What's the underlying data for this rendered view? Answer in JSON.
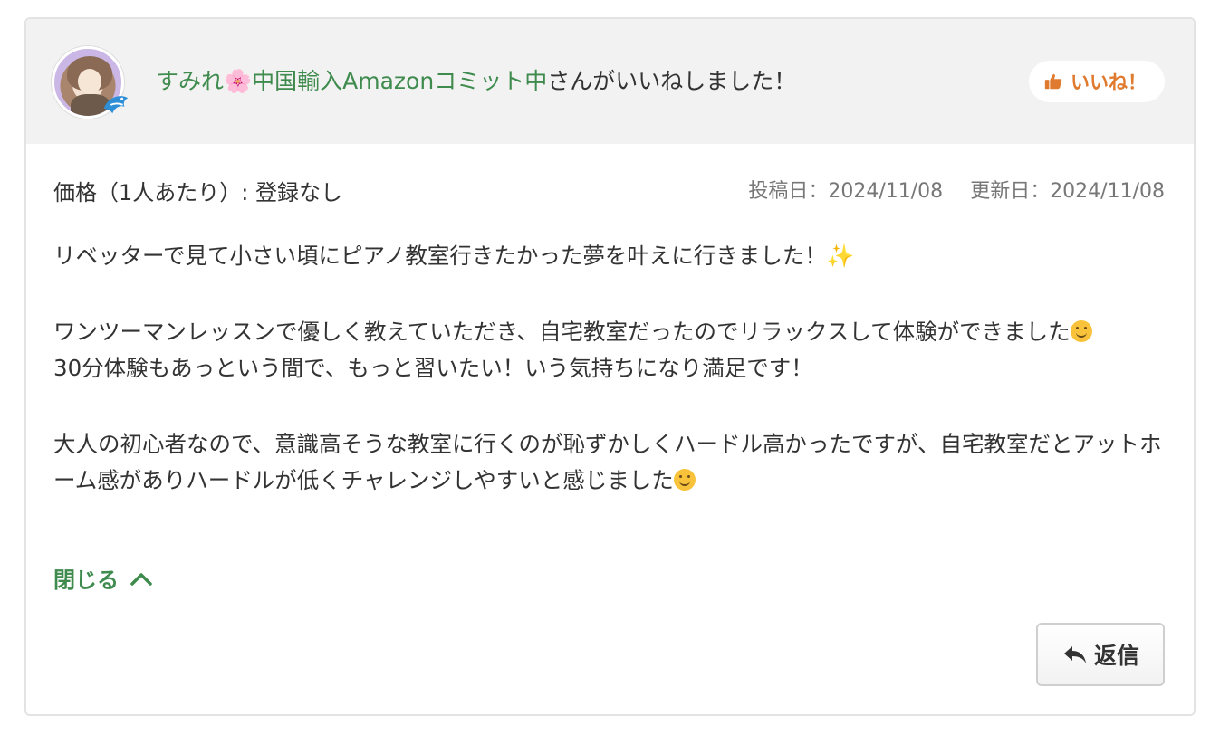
{
  "header": {
    "user_name_part1": "すみれ",
    "user_name_flower": "🌸",
    "user_name_part2": "中国輸入Amazonコミット中",
    "liked_suffix": "さんがいいねしました！",
    "like_button_label": "いいね！"
  },
  "meta": {
    "price": "価格（1人あたり）: 登録なし",
    "posted_date": "投稿日：2024/11/08",
    "updated_date": "更新日：2024/11/08"
  },
  "review": {
    "para1": "リベッターで見て小さい頃にピアノ教室行きたかった夢を叶えに行きました！",
    "para1_emoji": "✨",
    "para2_line1": "ワンツーマンレッスンで優しく教えていただき、自宅教室だったのでリラックスして体験ができました",
    "para2_line2": "30分体験もあっという間で、もっと習いたい！いう気持ちになり満足です！",
    "para3": "大人の初心者なので、意識高そうな教室に行くのが恥ずかしくハードル高かったですが、自宅教室だとアットホーム感がありハードルが低くチャレンジしやすいと感じました"
  },
  "actions": {
    "close_label": "閉じる",
    "reply_label": "返信"
  },
  "colors": {
    "accent_green": "#3f8b4e",
    "like_orange": "#e07a2e",
    "header_bg": "#f2f2f2"
  }
}
